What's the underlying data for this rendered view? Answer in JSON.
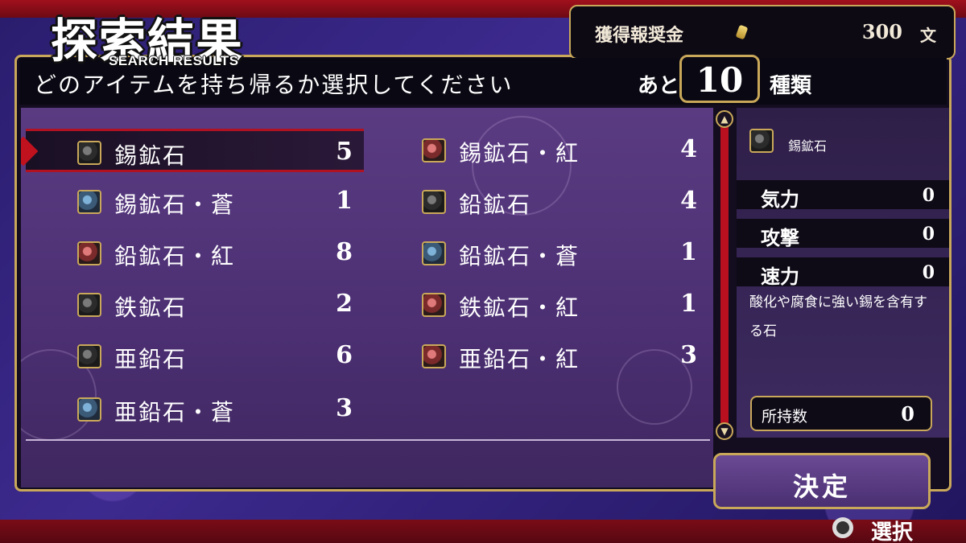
{
  "header": {
    "title_jp": "探索結果",
    "title_en": "SEARCH RESULTS"
  },
  "reward": {
    "label": "獲得報奨金",
    "value": "300",
    "unit": "文",
    "icon": "coin-icon"
  },
  "prompt": {
    "text": "どのアイテムを持ち帰るか選択してください",
    "remaining_prefix": "あと",
    "remaining_count": "10",
    "remaining_suffix": "種類"
  },
  "items": [
    {
      "name": "錫鉱石",
      "count": "5",
      "variant": "plain",
      "selected": true
    },
    {
      "name": "錫鉱石・紅",
      "count": "4",
      "variant": "beni"
    },
    {
      "name": "錫鉱石・蒼",
      "count": "1",
      "variant": "ao"
    },
    {
      "name": "鉛鉱石",
      "count": "4",
      "variant": "plain"
    },
    {
      "name": "鉛鉱石・紅",
      "count": "8",
      "variant": "beni"
    },
    {
      "name": "鉛鉱石・蒼",
      "count": "1",
      "variant": "ao"
    },
    {
      "name": "鉄鉱石",
      "count": "2",
      "variant": "plain"
    },
    {
      "name": "鉄鉱石・紅",
      "count": "1",
      "variant": "beni"
    },
    {
      "name": "亜鉛石",
      "count": "6",
      "variant": "plain"
    },
    {
      "name": "亜鉛石・紅",
      "count": "3",
      "variant": "beni"
    },
    {
      "name": "亜鉛石・蒼",
      "count": "3",
      "variant": "ao"
    }
  ],
  "detail": {
    "name": "錫鉱石",
    "stats": [
      {
        "label": "気力",
        "value": "0"
      },
      {
        "label": "攻撃",
        "value": "0"
      },
      {
        "label": "速力",
        "value": "0"
      }
    ],
    "description": "酸化や腐食に強い錫を含有する石",
    "owned_label": "所持数",
    "owned_value": "0"
  },
  "actions": {
    "confirm_label": "決定",
    "hint_label": "選択",
    "hint_icon": "circle-button-icon"
  },
  "colors": {
    "accent_gold": "#c9a85a",
    "selection_red": "#b01222",
    "panel_purple": "#4b2f72"
  }
}
